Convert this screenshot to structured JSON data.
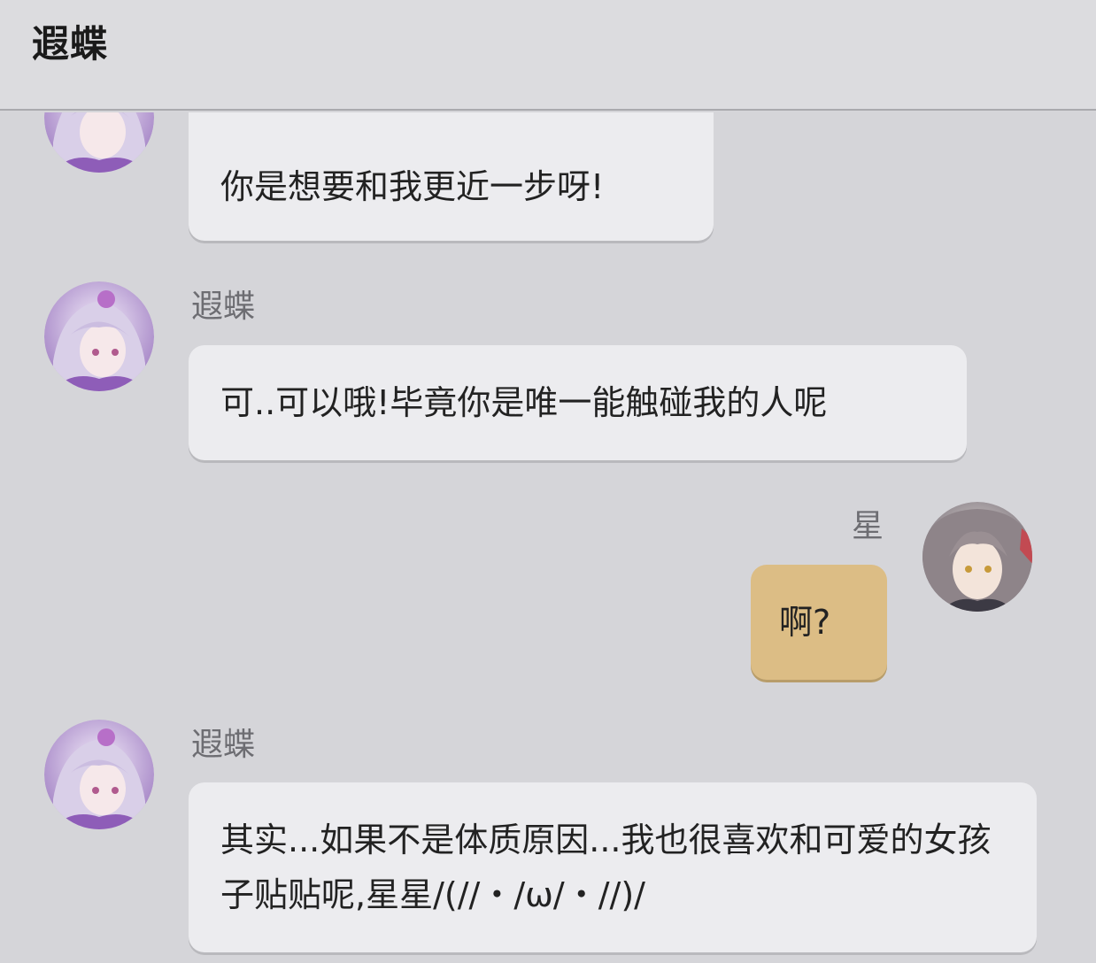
{
  "header": {
    "title": "遐蝶"
  },
  "messages": [
    {
      "sender": "",
      "side": "left",
      "avatar": "castorice-avatar",
      "text": "你是想要和我更近一步呀!"
    },
    {
      "sender": "遐蝶",
      "side": "left",
      "avatar": "castorice-avatar",
      "text": "可..可以哦!毕竟你是唯一能触碰我的人呢"
    },
    {
      "sender": "星",
      "side": "right",
      "avatar": "stelle-avatar",
      "text": "啊?"
    },
    {
      "sender": "遐蝶",
      "side": "left",
      "avatar": "castorice-avatar",
      "text": "其实...如果不是体质原因...我也很喜欢和可爱的女孩子贴贴呢,星星/(//・/ω/・//)/"
    }
  ],
  "colors": {
    "background": "#d5d5d9",
    "bubble_left": "#ececef",
    "bubble_right": "#dcbd85"
  }
}
